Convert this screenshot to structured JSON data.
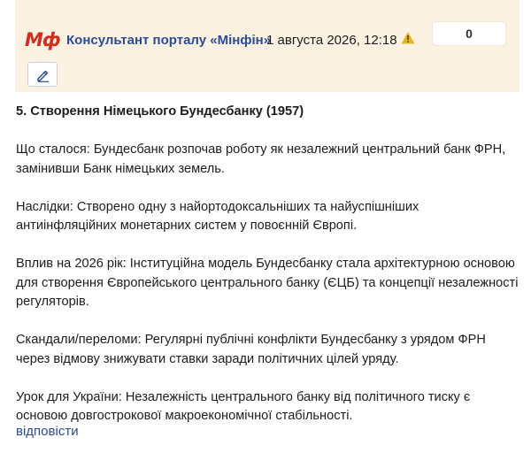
{
  "comment": {
    "logo_text": "Мф",
    "author": "Консультант порталу «Мінфін»",
    "date": "1 августа 2026, 12:18",
    "warning_icon": "warning-triangle-icon",
    "rating": "0",
    "edit_icon": "pencil-icon"
  },
  "body": {
    "title": "5. Створення Німецького Бундесбанку (1957)",
    "paragraphs": [
      "Що сталося: Бундесбанк розпочав роботу як незалежний центральний банк ФРН, замінивши Банк німецьких земель.",
      "Наслідки: Створено одну з найортодоксальніших та найуспішніших антиінфляційних монетарних систем у повоєнній Європі.",
      "Вплив на 2026 рік: Інституційна модель Бундесбанку стала архітектурною основою для створення Європейського центрального банку (ЄЦБ) та концепції незалежності регуляторів.",
      "Скандали/переломи: Регулярні публічні конфлікти Бундесбанку з урядом ФРН через відмову знижувати ставки заради політичних цілей уряду.",
      "Урок для України: Незалежність центрального банку від політичного тиску є основою довгострокової макроекономічної стабільності."
    ]
  },
  "actions": {
    "reply": "відповісти"
  },
  "colors": {
    "header_bg": "#fbf2e1",
    "brand_red": "#d92a1c",
    "link_blue": "#2b4c9a",
    "warning_yellow": "#e8b424"
  }
}
